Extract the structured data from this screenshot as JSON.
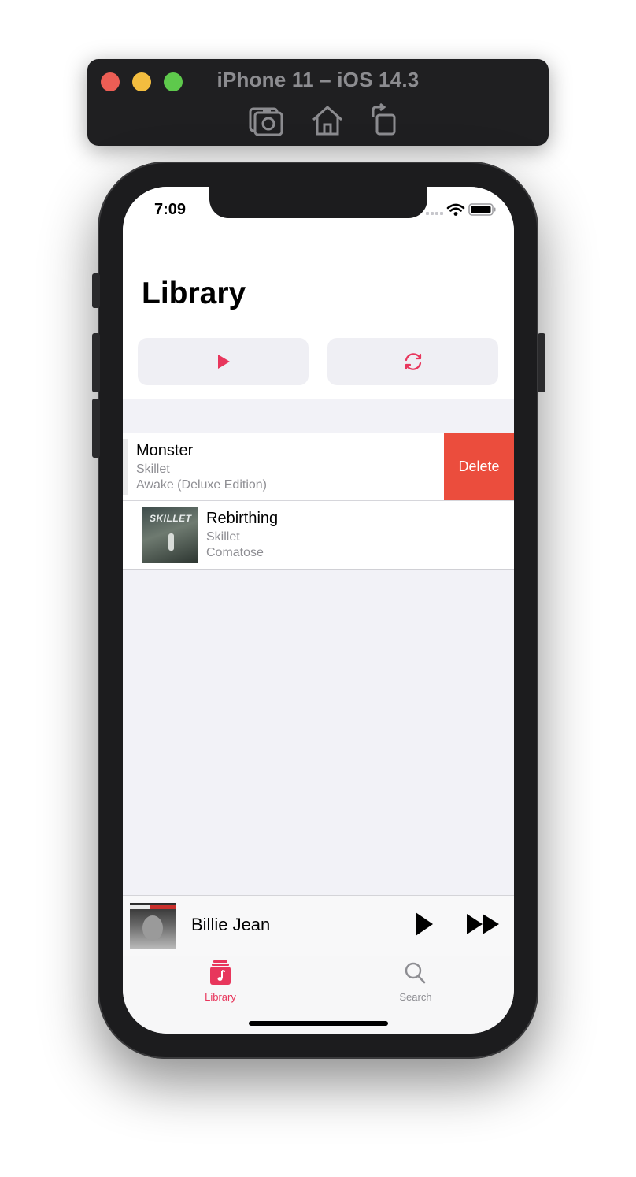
{
  "simulator": {
    "title": "iPhone 11 – iOS 14.3",
    "toolbar": [
      {
        "icon": "screenshot-icon"
      },
      {
        "icon": "home-icon"
      },
      {
        "icon": "rotate-icon"
      }
    ],
    "traffic_lights": [
      "close",
      "minimize",
      "zoom"
    ]
  },
  "status_bar": {
    "time": "7:09",
    "icons": [
      "signal-icon",
      "wifi-icon",
      "battery-icon"
    ]
  },
  "library": {
    "title": "Library",
    "actions": [
      {
        "icon": "play-icon",
        "color": "#e8365c"
      },
      {
        "icon": "shuffle-icon",
        "color": "#e8365c"
      }
    ]
  },
  "songs": [
    {
      "title": "Monster",
      "artist": "Skillet",
      "album": "Awake (Deluxe Edition)",
      "swipe_action": "Delete"
    },
    {
      "title": "Rebirthing",
      "artist": "Skillet",
      "album": "Comatose",
      "artwork_text": "SKILLET"
    }
  ],
  "mini_player": {
    "title": "Billie Jean",
    "controls": [
      "play-icon",
      "fast-forward-icon"
    ]
  },
  "tabs": [
    {
      "label": "Library",
      "icon": "music-library-icon",
      "active": true,
      "color": "#e8365c"
    },
    {
      "label": "Search",
      "icon": "search-icon",
      "active": false,
      "color": "#8e8e93"
    }
  ],
  "colors": {
    "accent": "#e8365c",
    "delete": "#eb4d3d",
    "secondary_text": "#8e8e93"
  }
}
